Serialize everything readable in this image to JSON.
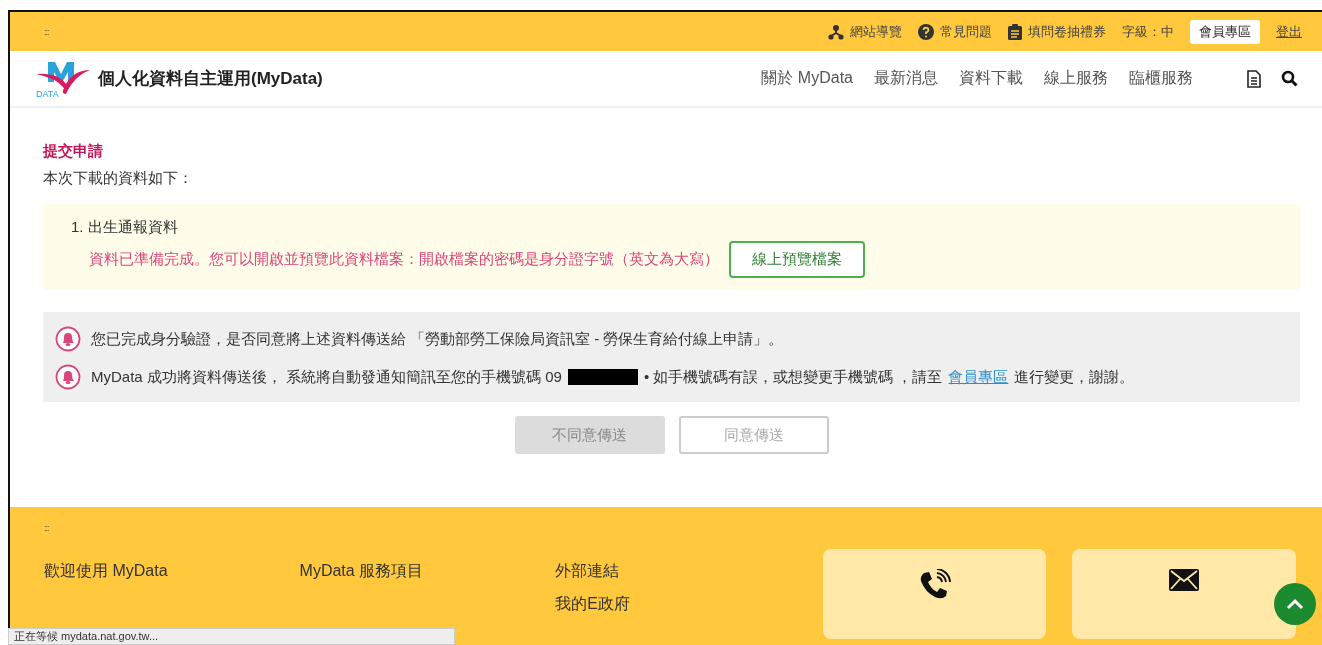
{
  "top_bar": {
    "grip": ":::",
    "links": [
      {
        "kind": "sitemap",
        "label": "網站導覽"
      },
      {
        "kind": "faq",
        "label": "常見問題"
      },
      {
        "kind": "survey",
        "label": "填問卷抽禮券"
      }
    ],
    "font_size_label": "字級：中",
    "member_button": "會員專區",
    "logout": "登出"
  },
  "header": {
    "title": "個人化資料自主運用(MyData)",
    "logo_text": "DATA",
    "nav": [
      {
        "label": "關於 MyData"
      },
      {
        "label": "最新消息"
      },
      {
        "label": "資料下載"
      },
      {
        "label": "線上服務"
      },
      {
        "label": "臨櫃服務"
      }
    ]
  },
  "main": {
    "heading": "提交申請",
    "intro": "本次下載的資料如下：",
    "items": [
      {
        "title": "1. 出生通報資料",
        "message": "資料已準備完成。您可以開啟並預覽此資料檔案：開啟檔案的密碼是身分證字號（英文為大寫）",
        "button": "線上預覽檔案"
      }
    ],
    "notices": [
      {
        "kind": "plain",
        "text": "您已完成身分驗證，是否同意將上述資料傳送給 「勞動部勞工保險局資訊室 - 勞保生育給付線上申請」。"
      },
      {
        "kind": "phone",
        "before": "MyData 成功將資料傳送後， 系統將自動發通知簡訊至您的手機號碼 09",
        "after": "• 如手機號碼有誤，或想變更手機號碼 ，請至",
        "link": "會員專區",
        "end": "進行變更，謝謝。"
      }
    ],
    "buttons": [
      {
        "kind": "filled",
        "label": "不同意傳送"
      },
      {
        "kind": "outline",
        "label": "同意傳送"
      }
    ]
  },
  "footer": {
    "grip": ":::",
    "columns": [
      {
        "heading": "歡迎使用 MyData"
      },
      {
        "heading": "MyData 服務項目"
      },
      {
        "heading": "外部連結",
        "links": [
          "我的E政府"
        ]
      }
    ],
    "cards": [
      {
        "kind": "phone"
      },
      {
        "kind": "mail"
      }
    ]
  },
  "status_bar": "正在等候 mydata.nat.gov.tw..."
}
